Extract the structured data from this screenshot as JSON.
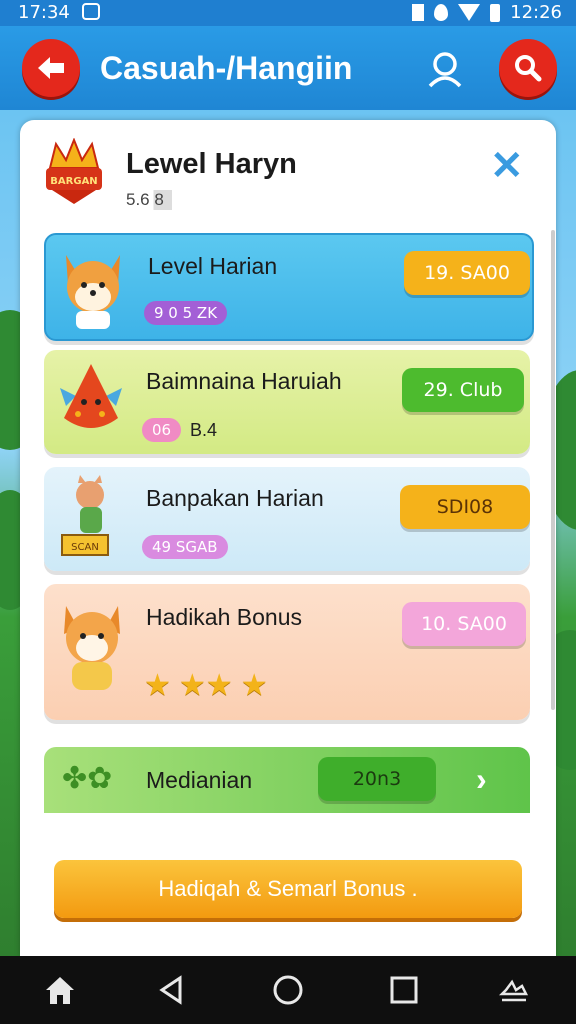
{
  "status_bar": {
    "time": "17:34",
    "clock": "12:26"
  },
  "app_bar": {
    "title": "Casuah-/Hangiin"
  },
  "modal": {
    "title": "Lewel Haryn",
    "subtitle": "5.6 8",
    "crown_text": "BARGAN",
    "rows": [
      {
        "label": "Level Harian",
        "badge": "9 0 5 ZK",
        "reward": "19. SA00",
        "badge_color": "#a35fd6",
        "reward_color": "#f5b21a"
      },
      {
        "label": "Baimnaina Haruiah",
        "badge": "06",
        "badge_extra": "B.4",
        "reward": "29. Club",
        "badge_color": "#f08bc4",
        "reward_color": "#4dbb2e"
      },
      {
        "label": "Banpakan Harian",
        "badge": "49 SGAB",
        "reward": "SDI08",
        "badge_color": "#d98be0",
        "reward_color": "#f5b21a",
        "tag": "SCAN"
      },
      {
        "label": "Hadikah Bonus",
        "reward": "10. SA00",
        "reward_color": "#f3a6da"
      },
      {
        "label": "Medianian",
        "reward": "20n3",
        "reward_color": "#3fae2b"
      }
    ],
    "stars": [
      "★",
      "★★",
      "★"
    ],
    "bonus_button": "Hadiqah & Semarl Bonus ."
  },
  "icons": {
    "back": "back-arrow-icon",
    "search": "search-icon",
    "user": "user-icon",
    "close": "close-icon",
    "chevron": "chevron-right-icon"
  }
}
